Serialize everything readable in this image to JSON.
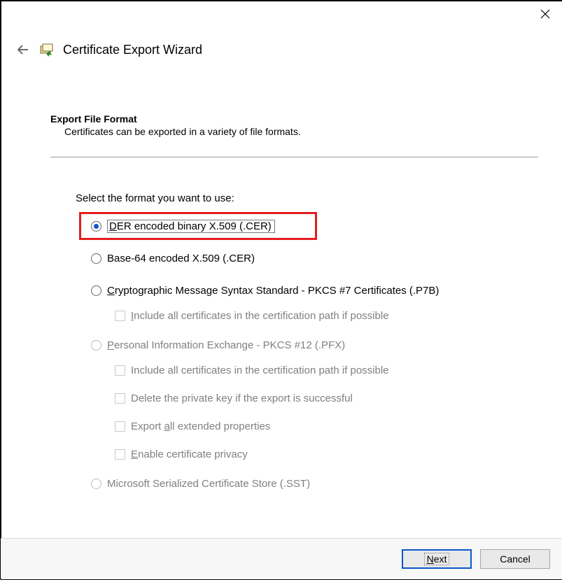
{
  "window": {
    "wizard_title": "Certificate Export Wizard"
  },
  "section": {
    "title": "Export File Format",
    "description": "Certificates can be exported in a variety of file formats."
  },
  "prompt": "Select the format you want to use:",
  "options": {
    "der_pre": "D",
    "der_rest": "ER encoded binary X.509 (.CER)",
    "base64": "Base-64 encoded X.509 (.CER)",
    "pkcs7_pre": "C",
    "pkcs7_rest": "ryptographic Message Syntax Standard - PKCS #7 Certificates (.P7B)",
    "pkcs7_include_pre": "I",
    "pkcs7_include_rest": "nclude all certificates in the certification path if possible",
    "pfx_pre": "P",
    "pfx_rest": "ersonal Information Exchange - PKCS #12 (.PFX)",
    "pfx_include": "Include all certificates in the certification path if possible",
    "pfx_delete": "Delete the private key if the export is successful",
    "pfx_export_pre": "Export ",
    "pfx_export_mid": "a",
    "pfx_export_rest": "ll extended properties",
    "pfx_privacy_pre": "E",
    "pfx_privacy_rest": "nable certificate privacy",
    "sst": "Microsoft Serialized Certificate Store (.SST)"
  },
  "buttons": {
    "next_pre": "N",
    "next_rest": "ext",
    "cancel": "Cancel"
  }
}
